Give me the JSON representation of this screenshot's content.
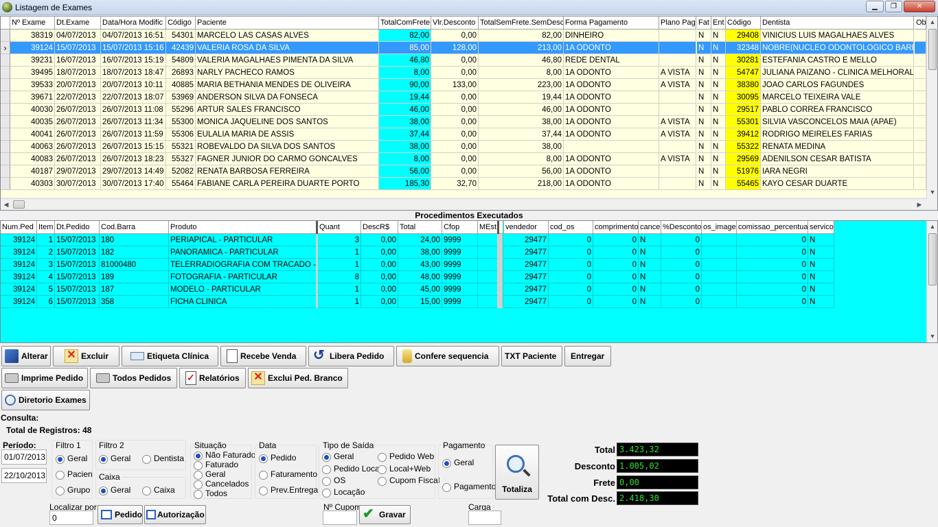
{
  "window": {
    "title": "Listagem de Exames",
    "min": "0",
    "max": "1",
    "close": "r"
  },
  "colors": {
    "selected": "#3399ff",
    "cyan": "#00ffff",
    "yellow": "#ffff00",
    "rowbg": "#ffffe1",
    "ind": "#e8e8e8"
  },
  "grid1": {
    "headers": [
      "Nº Exame",
      "Dt.Exame",
      "Data/Hora Modific",
      "Código",
      "Paciente",
      "TotalComFrete",
      "Vlr.Desconto",
      "TotalSemFrete.SemDesc",
      "Forma Pagamento",
      "Plano Pag",
      "Fat",
      "Ent",
      "Código",
      "Dentista",
      "Ob"
    ],
    "rows": [
      [
        "38319",
        "04/07/2013",
        "04/07/2013 16:51",
        "54301",
        "MARCELO LAS CASAS ALVES",
        "82,00",
        "0,00",
        "82,00",
        "DINHEIRO",
        "",
        "N",
        "N",
        "29408",
        "VINICIUS LUIS MAGALHAES ALVES"
      ],
      [
        "39124",
        "15/07/2013",
        "15/07/2013 15:16",
        "42439",
        "VALERIA ROSA DA SILVA",
        "85,00",
        "128,00",
        "213,00",
        "1A ODONTO",
        "",
        "N",
        "N",
        "32348",
        "NOBRE(NUCLEO ODONTOLOGICO BARR"
      ],
      [
        "39231",
        "16/07/2013",
        "16/07/2013 15:19",
        "54809",
        "VALERIA MAGALHAES PIMENTA DA SILVA",
        "46,80",
        "0,00",
        "46,80",
        "REDE DENTAL",
        "",
        "N",
        "N",
        "30281",
        "ESTEFANIA CASTRO E MELLO"
      ],
      [
        "39495",
        "18/07/2013",
        "18/07/2013 18:47",
        "26893",
        "NARLY PACHECO RAMOS",
        "8,00",
        "0,00",
        "8,00",
        "1A ODONTO",
        "A VISTA",
        "N",
        "N",
        "54747",
        "JULIANA PAIZANO - CLINICA MELHORAL"
      ],
      [
        "39533",
        "20/07/2013",
        "20/07/2013 10:11",
        "40885",
        "MARIA BETHANIA MENDES DE OLIVEIRA",
        "90,00",
        "133,00",
        "223,00",
        "1A ODONTO",
        "A VISTA",
        "N",
        "N",
        "38380",
        "JOAO CARLOS FAGUNDES"
      ],
      [
        "39671",
        "22/07/2013",
        "22/07/2013 18:07",
        "53969",
        "ANDERSON SILVA DA FONSECA",
        "19,44",
        "0,00",
        "19,44",
        "1A ODONTO",
        "",
        "N",
        "N",
        "30095",
        "MARCELO TEIXEIRA VALE"
      ],
      [
        "40030",
        "26/07/2013",
        "26/07/2013 11:08",
        "55296",
        "ARTUR SALES FRANCISCO",
        "46,00",
        "0,00",
        "46,00",
        "1A ODONTO",
        "",
        "N",
        "N",
        "29517",
        "PABLO CORREA FRANCISCO"
      ],
      [
        "40035",
        "26/07/2013",
        "26/07/2013 11:34",
        "55300",
        "MONICA JAQUELINE DOS SANTOS",
        "38,00",
        "0,00",
        "38,00",
        "1A ODONTO",
        "A VISTA",
        "N",
        "N",
        "55301",
        "SILVIA VASCONCELOS MAIA (APAE)"
      ],
      [
        "40041",
        "26/07/2013",
        "26/07/2013 11:59",
        "55306",
        "EULALIA MARIA DE ASSIS",
        "37,44",
        "0,00",
        "37,44",
        "1A ODONTO",
        "A VISTA",
        "N",
        "N",
        "39412",
        "RODRIGO MEIRELES FARIAS"
      ],
      [
        "40063",
        "26/07/2013",
        "26/07/2013 15:15",
        "55321",
        "ROBEVALDO DA SILVA DOS SANTOS",
        "38,00",
        "0,00",
        "38,00",
        "",
        "",
        "N",
        "N",
        "55322",
        "RENATA MEDINA"
      ],
      [
        "40083",
        "26/07/2013",
        "26/07/2013 18:23",
        "55327",
        "FAGNER JUNIOR DO CARMO GONCALVES",
        "8,00",
        "0,00",
        "8,00",
        "1A ODONTO",
        "A VISTA",
        "N",
        "N",
        "29569",
        "ADENILSON CESAR BATISTA"
      ],
      [
        "40187",
        "29/07/2013",
        "29/07/2013 14:49",
        "52082",
        "RENATA BARBOSA FERREIRA",
        "56,00",
        "0,00",
        "56,00",
        "1A ODONTO",
        "",
        "N",
        "N",
        "51976",
        "IARA NEGRI"
      ],
      [
        "40303",
        "30/07/2013",
        "30/07/2013 17:40",
        "55464",
        "FABIANE CARLA PEREIRA DUARTE PORTO",
        "185,30",
        "32,70",
        "218,00",
        "1A ODONTO",
        "",
        "N",
        "N",
        "55465",
        "KAYO CESAR DUARTE"
      ]
    ],
    "selected_row": 1,
    "indicator": "›"
  },
  "section_title": "Procedimentos Executados",
  "grid2": {
    "headers": [
      "Num.Ped",
      "Item",
      "Dt.Pedido",
      "Cod.Barra",
      "Produto",
      "Quant",
      "DescR$",
      "Total",
      "Cfop",
      "MEst",
      "vendedor",
      "cod_os",
      "comprimento",
      "cance",
      "%Desconto",
      "os_image",
      "comissao_percentual",
      "servico"
    ],
    "rows": [
      [
        "39124",
        "1",
        "15/07/2013",
        "180",
        "PERIAPICAL - PARTICULAR",
        "3",
        "0,00",
        "24,00",
        "9999",
        "",
        "29477",
        "0",
        "0",
        "N",
        "0",
        "",
        "0",
        "N"
      ],
      [
        "39124",
        "2",
        "15/07/2013",
        "182",
        "PANORAMICA - PARTICULAR",
        "1",
        "0,00",
        "38,00",
        "9999",
        "",
        "29477",
        "0",
        "0",
        "N",
        "0",
        "",
        "0",
        "N"
      ],
      [
        "39124",
        "3",
        "15/07/2013",
        "81000480",
        "TELERRADIOGRAFIA COM TRACADO - P",
        "1",
        "0,00",
        "43,00",
        "9999",
        "",
        "29477",
        "0",
        "0",
        "N",
        "0",
        "",
        "0",
        "N"
      ],
      [
        "39124",
        "4",
        "15/07/2013",
        "189",
        "FOTOGRAFIA - PARTICULAR",
        "8",
        "0,00",
        "48,00",
        "9999",
        "",
        "29477",
        "0",
        "0",
        "N",
        "0",
        "",
        "0",
        "N"
      ],
      [
        "39124",
        "5",
        "15/07/2013",
        "187",
        "MODELO - PARTICULAR",
        "1",
        "0,00",
        "45,00",
        "9999",
        "",
        "29477",
        "0",
        "0",
        "N",
        "0",
        "",
        "0",
        "N"
      ],
      [
        "39124",
        "6",
        "15/07/2013",
        "358",
        "FICHA CLINICA",
        "1",
        "0,00",
        "15,00",
        "9999",
        "",
        "29477",
        "0",
        "0",
        "N",
        "0",
        "",
        "0",
        "N"
      ]
    ]
  },
  "buttons": {
    "alterar": "Alterar",
    "excluir": "Excluir",
    "etiqueta": "Etiqueta Clínica",
    "recebe": "Recebe Venda",
    "libera": "Libera Pedido",
    "confere": "Confere sequencia",
    "txt": "TXT Paciente",
    "entregar": "Entregar",
    "imprime": "Imprime Pedido",
    "todos": "Todos Pedidos",
    "relatorios": "Relatórios",
    "exclui_branco": "Exclui Ped. Branco",
    "diretorio": "Diretorio Exames",
    "pedido": "Pedido",
    "autorizacao": "Autorização",
    "gravar": "Gravar",
    "totaliza": "Totaliza"
  },
  "consulta": {
    "label": "Consulta:",
    "total_registros": "Total de Registros: 48"
  },
  "periodo": {
    "label": "Período:",
    "from": "01/07/2013",
    "to": "22/10/2013"
  },
  "filtro1": {
    "label": "Filtro 1",
    "options": [
      "Geral",
      "Pacien",
      "Grupo"
    ],
    "selected": 0
  },
  "filtro2": {
    "label": "Filtro 2",
    "options": [
      "Geral",
      "Dentista"
    ],
    "selected": 0
  },
  "caixa": {
    "label": "Caixa",
    "options": [
      "Geral",
      "Caixa"
    ],
    "selected": 0
  },
  "situacao": {
    "label": "Situação",
    "options": [
      "Não Faturado",
      "Faturado",
      "Geral",
      "Cancelados",
      "Todos"
    ],
    "selected": 0
  },
  "data": {
    "label": "Data",
    "options": [
      "Pedido",
      "Faturamento",
      "Prev.Entrega"
    ],
    "selected": 0
  },
  "tipo_saida": {
    "label": "Tipo de Saída",
    "options": [
      "Geral",
      "Pedido Web",
      "Pedido Local",
      "Local+Web",
      "OS",
      "Cupom Fiscal",
      "Locação"
    ],
    "selected": 0
  },
  "pagamento": {
    "label": "Pagamento",
    "options": [
      "Geral",
      "Pagamento"
    ],
    "selected": 0
  },
  "localizar": {
    "label": "Localizar por:",
    "value": "0"
  },
  "cupom": {
    "label": "Nº Cupom:",
    "value": ""
  },
  "carga": {
    "label": "Carga",
    "value": ""
  },
  "totais": {
    "total_label": "Total",
    "total": "3.423,32",
    "desconto_label": "Desconto",
    "desconto": "1.005,02",
    "frete_label": "Frete",
    "frete": "0,00",
    "com_desc_label": "Total com Desc.",
    "com_desc": "2.418,30"
  }
}
